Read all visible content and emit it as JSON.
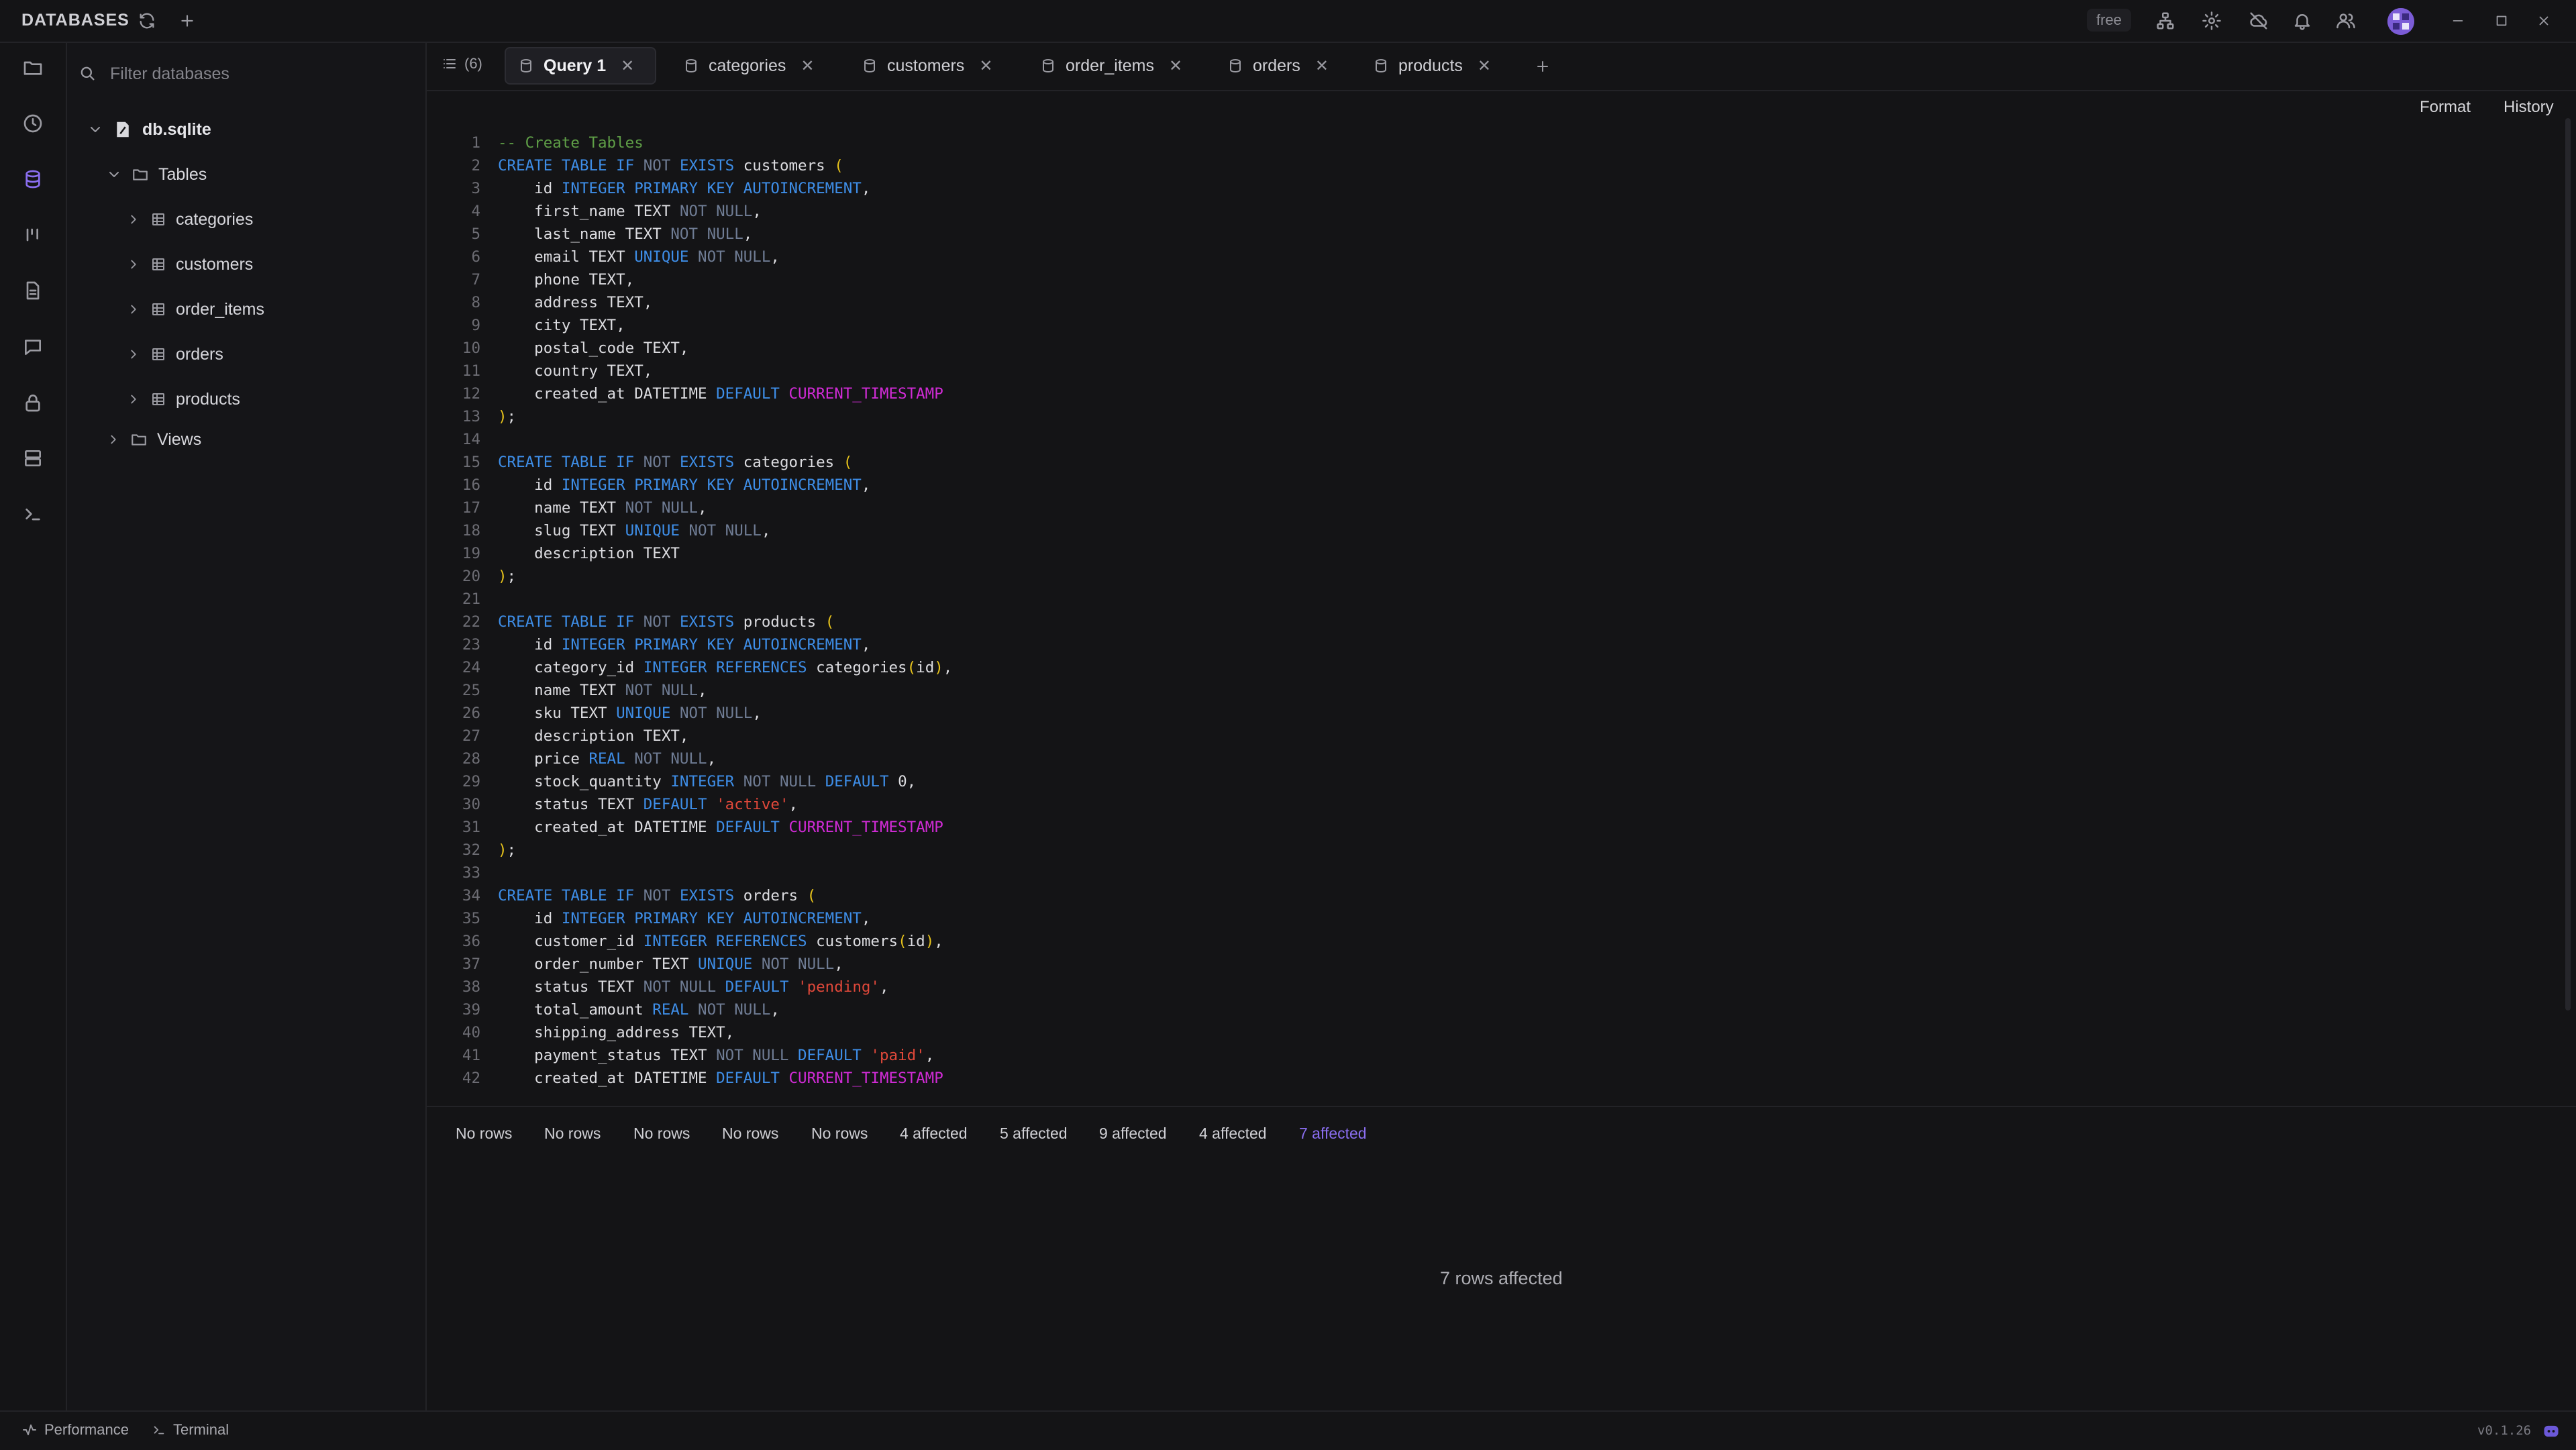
{
  "topbar": {
    "title": "DATABASES",
    "plan_badge": "free"
  },
  "sidebar": {
    "filter_placeholder": "Filter databases",
    "database": "db.sqlite",
    "tables_folder": "Tables",
    "tables": [
      "categories",
      "customers",
      "order_items",
      "orders",
      "products"
    ],
    "views_folder": "Views"
  },
  "tabs": {
    "count": "(6)",
    "items": [
      {
        "label": "Query 1",
        "active": true
      },
      {
        "label": "categories"
      },
      {
        "label": "customers"
      },
      {
        "label": "order_items"
      },
      {
        "label": "orders"
      },
      {
        "label": "products"
      }
    ]
  },
  "editor": {
    "format_label": "Format",
    "history_label": "History",
    "lines": [
      [
        [
          "cm",
          "-- Create Tables"
        ]
      ],
      [
        [
          "kw",
          "CREATE TABLE IF "
        ],
        [
          "nn",
          "NOT "
        ],
        [
          "kw",
          "EXISTS "
        ],
        [
          "id",
          "customers "
        ],
        [
          "br",
          "("
        ]
      ],
      [
        [
          "id",
          "    id "
        ],
        [
          "kw",
          "INTEGER PRIMARY KEY AUTOINCREMENT"
        ],
        [
          "id",
          ","
        ]
      ],
      [
        [
          "id",
          "    first_name TEXT "
        ],
        [
          "nn",
          "NOT NULL"
        ],
        [
          "id",
          ","
        ]
      ],
      [
        [
          "id",
          "    last_name TEXT "
        ],
        [
          "nn",
          "NOT NULL"
        ],
        [
          "id",
          ","
        ]
      ],
      [
        [
          "id",
          "    email TEXT "
        ],
        [
          "kw",
          "UNIQUE "
        ],
        [
          "nn",
          "NOT NULL"
        ],
        [
          "id",
          ","
        ]
      ],
      [
        [
          "id",
          "    phone TEXT,"
        ]
      ],
      [
        [
          "id",
          "    address TEXT,"
        ]
      ],
      [
        [
          "id",
          "    city TEXT,"
        ]
      ],
      [
        [
          "id",
          "    postal_code TEXT,"
        ]
      ],
      [
        [
          "id",
          "    country TEXT,"
        ]
      ],
      [
        [
          "id",
          "    created_at DATETIME "
        ],
        [
          "kw",
          "DEFAULT "
        ],
        [
          "fn",
          "CURRENT_TIMESTAMP"
        ]
      ],
      [
        [
          "br",
          ")"
        ],
        [
          "id",
          ";"
        ]
      ],
      [],
      [
        [
          "kw",
          "CREATE TABLE IF "
        ],
        [
          "nn",
          "NOT "
        ],
        [
          "kw",
          "EXISTS "
        ],
        [
          "id",
          "categories "
        ],
        [
          "br",
          "("
        ]
      ],
      [
        [
          "id",
          "    id "
        ],
        [
          "kw",
          "INTEGER PRIMARY KEY AUTOINCREMENT"
        ],
        [
          "id",
          ","
        ]
      ],
      [
        [
          "id",
          "    name TEXT "
        ],
        [
          "nn",
          "NOT NULL"
        ],
        [
          "id",
          ","
        ]
      ],
      [
        [
          "id",
          "    slug TEXT "
        ],
        [
          "kw",
          "UNIQUE "
        ],
        [
          "nn",
          "NOT NULL"
        ],
        [
          "id",
          ","
        ]
      ],
      [
        [
          "id",
          "    description TEXT"
        ]
      ],
      [
        [
          "br",
          ")"
        ],
        [
          "id",
          ";"
        ]
      ],
      [],
      [
        [
          "kw",
          "CREATE TABLE IF "
        ],
        [
          "nn",
          "NOT "
        ],
        [
          "kw",
          "EXISTS "
        ],
        [
          "id",
          "products "
        ],
        [
          "br",
          "("
        ]
      ],
      [
        [
          "id",
          "    id "
        ],
        [
          "kw",
          "INTEGER PRIMARY KEY AUTOINCREMENT"
        ],
        [
          "id",
          ","
        ]
      ],
      [
        [
          "id",
          "    category_id "
        ],
        [
          "kw",
          "INTEGER REFERENCES "
        ],
        [
          "id",
          "categories"
        ],
        [
          "br",
          "("
        ],
        [
          "id",
          "id"
        ],
        [
          "br",
          ")"
        ],
        [
          "id",
          ","
        ]
      ],
      [
        [
          "id",
          "    name TEXT "
        ],
        [
          "nn",
          "NOT NULL"
        ],
        [
          "id",
          ","
        ]
      ],
      [
        [
          "id",
          "    sku TEXT "
        ],
        [
          "kw",
          "UNIQUE "
        ],
        [
          "nn",
          "NOT NULL"
        ],
        [
          "id",
          ","
        ]
      ],
      [
        [
          "id",
          "    description TEXT,"
        ]
      ],
      [
        [
          "id",
          "    price "
        ],
        [
          "kw",
          "REAL "
        ],
        [
          "nn",
          "NOT NULL"
        ],
        [
          "id",
          ","
        ]
      ],
      [
        [
          "id",
          "    stock_quantity "
        ],
        [
          "kw",
          "INTEGER "
        ],
        [
          "nn",
          "NOT NULL "
        ],
        [
          "kw",
          "DEFAULT "
        ],
        [
          "id",
          "0,"
        ]
      ],
      [
        [
          "id",
          "    status TEXT "
        ],
        [
          "kw",
          "DEFAULT "
        ],
        [
          "str",
          "'active'"
        ],
        [
          "id",
          ","
        ]
      ],
      [
        [
          "id",
          "    created_at DATETIME "
        ],
        [
          "kw",
          "DEFAULT "
        ],
        [
          "fn",
          "CURRENT_TIMESTAMP"
        ]
      ],
      [
        [
          "br",
          ")"
        ],
        [
          "id",
          ";"
        ]
      ],
      [],
      [
        [
          "kw",
          "CREATE TABLE IF "
        ],
        [
          "nn",
          "NOT "
        ],
        [
          "kw",
          "EXISTS "
        ],
        [
          "id",
          "orders "
        ],
        [
          "br",
          "("
        ]
      ],
      [
        [
          "id",
          "    id "
        ],
        [
          "kw",
          "INTEGER PRIMARY KEY AUTOINCREMENT"
        ],
        [
          "id",
          ","
        ]
      ],
      [
        [
          "id",
          "    customer_id "
        ],
        [
          "kw",
          "INTEGER REFERENCES "
        ],
        [
          "id",
          "customers"
        ],
        [
          "br",
          "("
        ],
        [
          "id",
          "id"
        ],
        [
          "br",
          ")"
        ],
        [
          "id",
          ","
        ]
      ],
      [
        [
          "id",
          "    order_number TEXT "
        ],
        [
          "kw",
          "UNIQUE "
        ],
        [
          "nn",
          "NOT NULL"
        ],
        [
          "id",
          ","
        ]
      ],
      [
        [
          "id",
          "    status TEXT "
        ],
        [
          "nn",
          "NOT NULL "
        ],
        [
          "kw",
          "DEFAULT "
        ],
        [
          "str",
          "'pending'"
        ],
        [
          "id",
          ","
        ]
      ],
      [
        [
          "id",
          "    total_amount "
        ],
        [
          "kw",
          "REAL "
        ],
        [
          "nn",
          "NOT NULL"
        ],
        [
          "id",
          ","
        ]
      ],
      [
        [
          "id",
          "    shipping_address TEXT,"
        ]
      ],
      [
        [
          "id",
          "    payment_status TEXT "
        ],
        [
          "nn",
          "NOT NULL "
        ],
        [
          "kw",
          "DEFAULT "
        ],
        [
          "str",
          "'paid'"
        ],
        [
          "id",
          ","
        ]
      ],
      [
        [
          "id",
          "    created_at DATETIME "
        ],
        [
          "kw",
          "DEFAULT "
        ],
        [
          "fn",
          "CURRENT_TIMESTAMP"
        ]
      ]
    ]
  },
  "results": {
    "tabs": [
      "No rows",
      "No rows",
      "No rows",
      "No rows",
      "No rows",
      "4 affected",
      "5 affected",
      "9 affected",
      "4 affected",
      "7 affected"
    ],
    "active_index": 9,
    "message": "7 rows affected"
  },
  "statusbar": {
    "performance": "Performance",
    "terminal": "Terminal",
    "version": "v0.1.26"
  },
  "colors": {
    "accent": "#8a6ef0",
    "keyword": "#3e8ee8",
    "function": "#d12bd6",
    "string": "#e0483a",
    "comment": "#5f9f47"
  }
}
